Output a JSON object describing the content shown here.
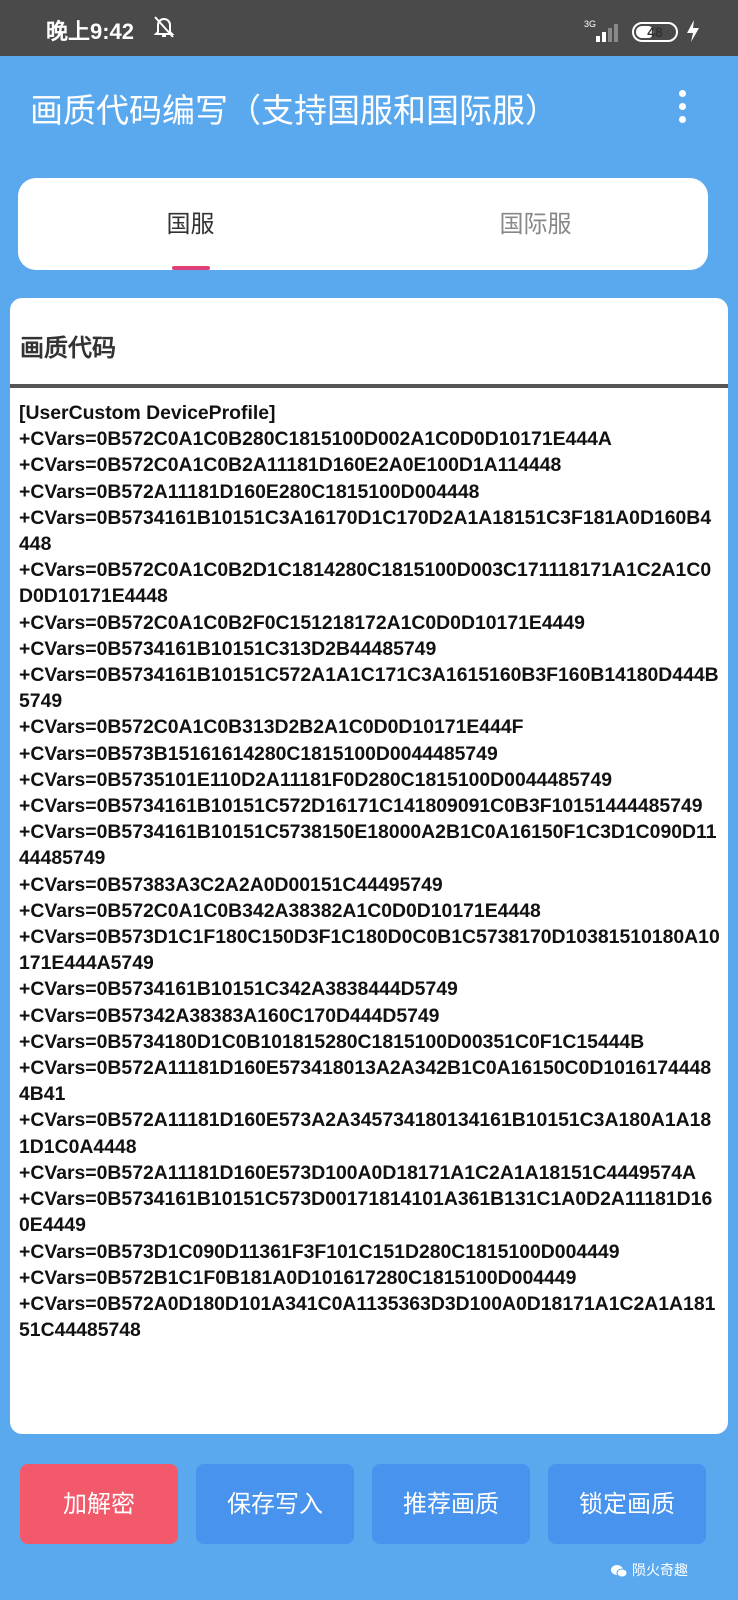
{
  "status_bar": {
    "time": "晚上9:42",
    "network": "3G",
    "battery_level": "48",
    "battery_fraction": 0.48
  },
  "app_bar": {
    "title": "画质代码编写（支持国服和国际服）",
    "menu_icon": "more-vert-icon"
  },
  "tabs": [
    {
      "label": "国服",
      "selected": true
    },
    {
      "label": "国际服",
      "selected": false
    }
  ],
  "editor": {
    "label": "画质代码",
    "content": "[UserCustom DeviceProfile]\n+CVars=0B572C0A1C0B280C1815100D002A1C0D0D10171E444A\n+CVars=0B572C0A1C0B2A11181D160E2A0E100D1A114448\n+CVars=0B572A11181D160E280C1815100D004448\n+CVars=0B5734161B10151C3A16170D1C170D2A1A18151C3F181A0D160B4448\n+CVars=0B572C0A1C0B2D1C1814280C1815100D003C171118171A1C2A1C0D0D10171E4448\n+CVars=0B572C0A1C0B2F0C151218172A1C0D0D10171E4449\n+CVars=0B5734161B10151C313D2B44485749\n+CVars=0B5734161B10151C572A1A1C171C3A1615160B3F160B14180D444B5749\n+CVars=0B572C0A1C0B313D2B2A1C0D0D10171E444F\n+CVars=0B573B15161614280C1815100D0044485749\n+CVars=0B5735101E110D2A11181F0D280C1815100D0044485749\n+CVars=0B5734161B10151C572D16171C141809091C0B3F10151444485749\n+CVars=0B5734161B10151C5738150E18000A2B1C0A16150F1C3D1C090D1144485749\n+CVars=0B57383A3C2A2A0D00151C44495749\n+CVars=0B572C0A1C0B342A38382A1C0D0D10171E4448\n+CVars=0B573D1C1F180C150D3F1C180D0C0B1C5738170D10381510180A10171E444A5749\n+CVars=0B5734161B10151C342A3838444D5749\n+CVars=0B57342A38383A160C170D444D5749\n+CVars=0B5734180D1C0B101815280C1815100D00351C0F1C15444B\n+CVars=0B572A11181D160E573418013A2A342B1C0A16150C0D10161744484B41\n+CVars=0B572A11181D160E573A2A345734180134161B10151C3A180A1A181D1C0A4448\n+CVars=0B572A11181D160E573D100A0D18171A1C2A1A18151C4449574A\n+CVars=0B5734161B10151C573D00171814101A361B131C1A0D2A11181D160E4449\n+CVars=0B573D1C090D11361F3F101C151D280C1815100D004449\n+CVars=0B572B1C1F0B181A0D101617280C1815100D004449\n+CVars=0B572A0D180D101A341C0A1135363D3D100A0D18171A1C2A1A18151C44485748"
  },
  "actions": [
    {
      "label": "加解密",
      "color": "#f2596a"
    },
    {
      "label": "保存写入",
      "color": "#4893ee"
    },
    {
      "label": "推荐画质",
      "color": "#4893ee"
    },
    {
      "label": "锁定画质",
      "color": "#4893ee"
    }
  ],
  "watermark": "陨火奇趣",
  "colors": {
    "background": "#5aa9ef",
    "status_bar": "#4a4a4a",
    "tab_indicator": "#e0407a"
  }
}
